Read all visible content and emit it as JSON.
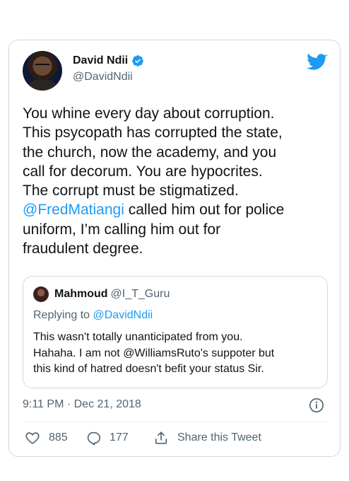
{
  "tweet": {
    "author_name": "David Ndii",
    "author_handle": "@DavidNdii",
    "text_lines_before": "You whine every day about corruption.\nThis psycopath has corrupted the state,\nthe church, now the academy, and you\ncall for decorum. You are hypocrites.\nThe corrupt must be stigmatized.\n",
    "mention": "@FredMatiangi",
    "text_after": " called him out for police\nuniform, I’m calling him out for\nfraudulent degree.",
    "timestamp": "9:11 PM · Dec 21, 2018",
    "likes": "885",
    "replies": "177",
    "share_label": "Share this Tweet"
  },
  "quoted": {
    "author_name": "Mahmoud",
    "author_handle": "@I_T_Guru",
    "replying_prefix": "Replying to ",
    "replying_handle": "@DavidNdii",
    "text": "This wasn't totally unanticipated from you.\nHahaha. I am not @WilliamsRuto's suppoter but\nthis kind of hatred doesn't befit your status Sir."
  },
  "icons": {
    "verified": "verified-badge-icon",
    "twitter": "twitter-bird-icon",
    "info": "info-icon",
    "like": "heart-icon",
    "reply": "reply-bubble-icon",
    "share": "share-icon"
  },
  "colors": {
    "accent": "#1d9bf0",
    "secondary_text": "#536471",
    "border": "#cfd9de"
  }
}
